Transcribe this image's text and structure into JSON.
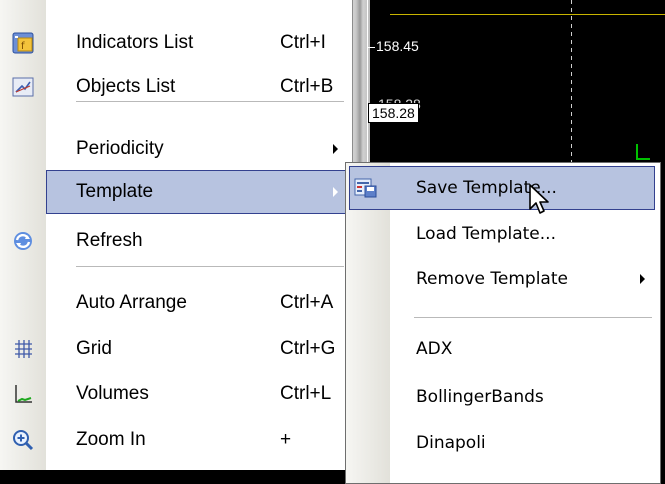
{
  "chart": {
    "price_top": "158.45",
    "price_ghost": "158.28",
    "price_current": "158.28",
    "colors": {
      "background": "#000000",
      "top_line": "#c8b400",
      "tick_green": "#00c000"
    }
  },
  "menu": {
    "items": [
      {
        "label": "Indicators List",
        "shortcut": "Ctrl+I",
        "icon": "indicators-list-icon"
      },
      {
        "label": "Objects List",
        "shortcut": "Ctrl+B",
        "icon": "objects-list-icon"
      },
      {
        "label": "Periodicity",
        "shortcut": "",
        "submenu": true
      },
      {
        "label": "Template",
        "shortcut": "",
        "submenu": true,
        "highlighted": true
      },
      {
        "label": "Refresh",
        "shortcut": "",
        "icon": "refresh-icon"
      },
      {
        "label": "Auto Arrange",
        "shortcut": "Ctrl+A"
      },
      {
        "label": "Grid",
        "shortcut": "Ctrl+G",
        "icon": "grid-icon"
      },
      {
        "label": "Volumes",
        "shortcut": "Ctrl+L",
        "icon": "volumes-icon"
      },
      {
        "label": "Zoom In",
        "shortcut": "+",
        "icon": "zoom-in-icon"
      }
    ],
    "highlight_color": "#b7c3e0",
    "highlight_border": "#33418f"
  },
  "submenu": {
    "items": [
      {
        "label": "Save Template...",
        "highlighted": true,
        "icon": "save-template-icon"
      },
      {
        "label": "Load Template..."
      },
      {
        "label": "Remove Template",
        "submenu": true
      },
      {
        "label": "ADX"
      },
      {
        "label": "BollingerBands"
      },
      {
        "label": "Dinapoli"
      }
    ]
  }
}
